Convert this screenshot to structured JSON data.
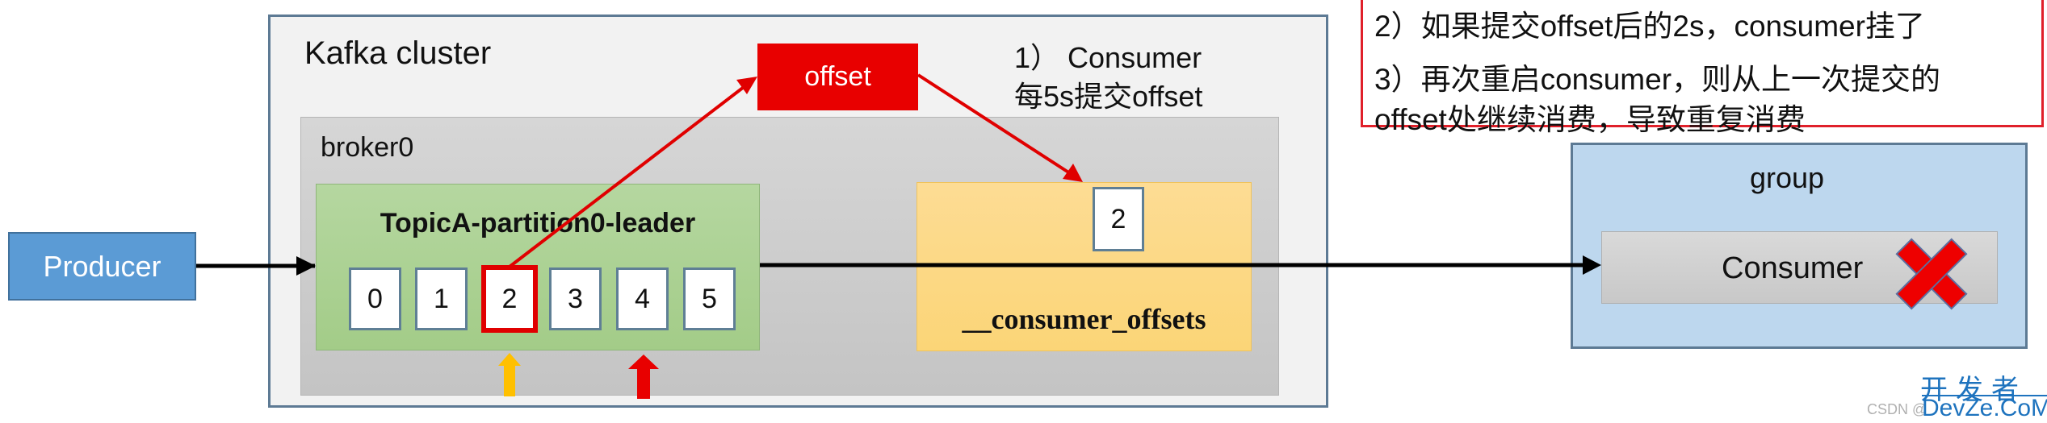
{
  "producer": {
    "label": "Producer"
  },
  "cluster": {
    "title": "Kafka cluster",
    "broker": {
      "title": "broker0",
      "partition": {
        "title": "TopicA-partition0-leader",
        "offsets": [
          "0",
          "1",
          "2",
          "3",
          "4",
          "5"
        ],
        "highlighted_offset_index": 2,
        "committed_marker_index": 2,
        "consumed_marker_index": 4
      },
      "consumer_offsets": {
        "label": "__consumer_offsets",
        "stored_value": "2"
      }
    },
    "offset_tag": "offset",
    "note": [
      "1） Consumer",
      "每5s提交offset"
    ]
  },
  "callout": {
    "lines": [
      "2）如果提交offset后的2s，consumer挂了",
      "3）再次重启consumer，则从上一次提交的",
      "offset处继续消费，导致重复消费"
    ]
  },
  "group": {
    "title": "group",
    "consumer": {
      "label": "Consumer",
      "status_icon": "red-x-icon"
    }
  },
  "watermark": {
    "cn": "开发者",
    "en": "DevZe.CoM",
    "csdn": "CSDN @"
  },
  "colors": {
    "producer": "#5b9bd5",
    "cluster_border": "#5d7a94",
    "partition": "#a9d18e",
    "offsets_box": "#fdd882",
    "offset_tag": "#e80000",
    "group": "#bdd7ee",
    "yellow_marker": "#ffc000",
    "red_marker": "#e80000",
    "callout_border": "#e0202a"
  }
}
